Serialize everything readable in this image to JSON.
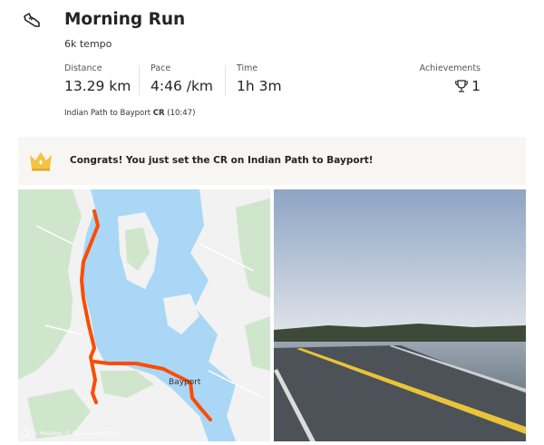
{
  "activity": {
    "icon": "running-shoe-icon",
    "title": "Morning Run",
    "description": "6k tempo"
  },
  "stats": {
    "distance": {
      "label": "Distance",
      "value": "13.29 km"
    },
    "pace": {
      "label": "Pace",
      "value": "4:46 /km"
    },
    "time": {
      "label": "Time",
      "value": "1h 3m"
    },
    "achievements": {
      "label": "Achievements",
      "value": "1",
      "icon": "trophy-icon"
    }
  },
  "segment": {
    "name": "Indian Path to Bayport",
    "badge": "CR",
    "time": "(10:47)"
  },
  "banner": {
    "icon": "crown-icon",
    "message": "Congrats! You just set the CR on Indian Path to Bayport!",
    "accent": "#f5c242"
  },
  "map": {
    "place_label": "Bayport",
    "attribution": "© Mapbox © OpenStreetMap",
    "route_color": "#fc4c02",
    "water_color": "#a9d7f5",
    "land_color": "#f1f2f1",
    "forest_color": "#cfe6cc"
  },
  "photo": {
    "icon": "road-photo-icon"
  }
}
